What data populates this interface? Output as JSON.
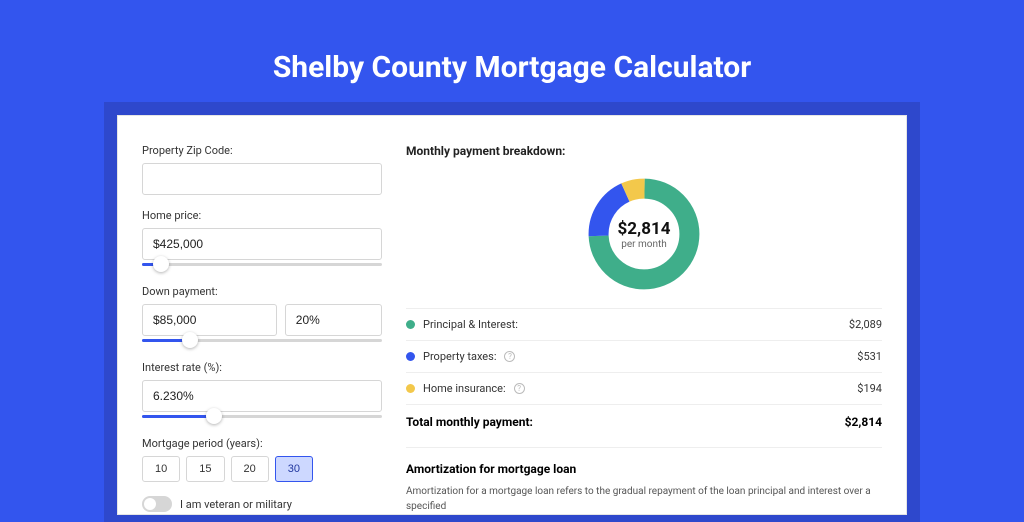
{
  "title": "Shelby County Mortgage Calculator",
  "form": {
    "zip_label": "Property Zip Code:",
    "zip_value": "",
    "home_price_label": "Home price:",
    "home_price_value": "$425,000",
    "down_payment_label": "Down payment:",
    "down_payment_amount": "$85,000",
    "down_payment_percent": "20%",
    "interest_label": "Interest rate (%):",
    "interest_value": "6.230%",
    "period_label": "Mortgage period (years):",
    "period_options": [
      "10",
      "15",
      "20",
      "30"
    ],
    "period_selected_index": 3,
    "veteran_label": "I am veteran or military"
  },
  "breakdown": {
    "title": "Monthly payment breakdown:",
    "center_amount": "$2,814",
    "center_sub": "per month",
    "rows": [
      {
        "label": "Principal & Interest:",
        "value": "$2,089",
        "color": "#3fae8a",
        "info": false
      },
      {
        "label": "Property taxes:",
        "value": "$531",
        "color": "#3355ee",
        "info": true
      },
      {
        "label": "Home insurance:",
        "value": "$194",
        "color": "#f3c84b",
        "info": true
      }
    ],
    "total_label": "Total monthly payment:",
    "total_value": "$2,814"
  },
  "amort": {
    "heading": "Amortization for mortgage loan",
    "text": "Amortization for a mortgage loan refers to the gradual repayment of the loan principal and interest over a specified"
  },
  "chart_data": {
    "type": "pie",
    "title": "Monthly payment breakdown",
    "series": [
      {
        "name": "Principal & Interest",
        "value": 2089,
        "color": "#3fae8a"
      },
      {
        "name": "Property taxes",
        "value": 531,
        "color": "#3355ee"
      },
      {
        "name": "Home insurance",
        "value": 194,
        "color": "#f3c84b"
      }
    ],
    "total": 2814,
    "center_label": "$2,814 per month"
  }
}
